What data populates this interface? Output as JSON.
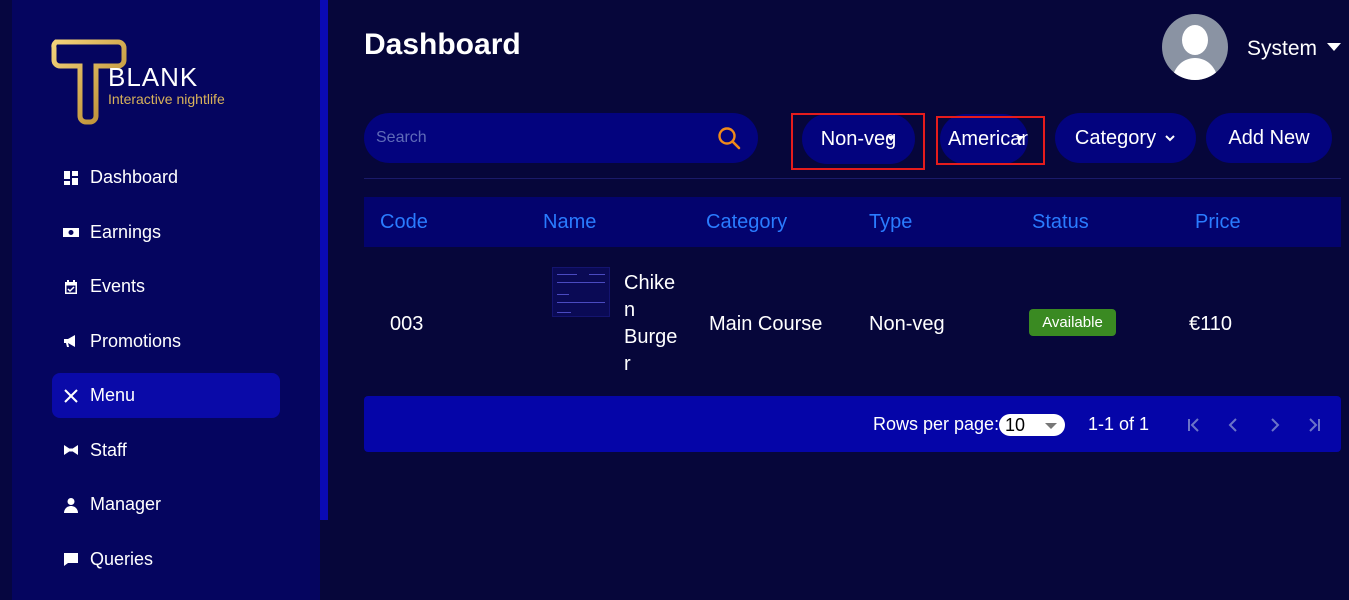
{
  "brand": {
    "title": "BLANK",
    "subtitle": "Interactive nightlife"
  },
  "sidebar": {
    "items": [
      {
        "label": "Dashboard",
        "icon": "dashboard-icon"
      },
      {
        "label": "Earnings",
        "icon": "money-icon"
      },
      {
        "label": "Events",
        "icon": "calendar-icon"
      },
      {
        "label": "Promotions",
        "icon": "megaphone-icon"
      },
      {
        "label": "Menu",
        "icon": "utensils-icon",
        "active": true
      },
      {
        "label": "Staff",
        "icon": "bowtie-icon"
      },
      {
        "label": "Manager",
        "icon": "manager-icon"
      },
      {
        "label": "Queries",
        "icon": "chat-icon"
      }
    ]
  },
  "header": {
    "title": "Dashboard",
    "user": "System"
  },
  "toolbar": {
    "search_placeholder": "Search",
    "filter_type": "Non-veg",
    "filter_cuisine": "American",
    "category_label": "Category",
    "add_label": "Add New"
  },
  "table": {
    "columns": [
      "Code",
      "Name",
      "Category",
      "Type",
      "Status",
      "Price"
    ],
    "rows": [
      {
        "code": "003",
        "name_lines": [
          "Chike",
          "n",
          "Burge",
          "r"
        ],
        "category": "Main Course",
        "type": "Non-veg",
        "status": "Available",
        "price": "€110"
      }
    ]
  },
  "pagination": {
    "rows_label": "Rows per page:",
    "rows_value": "10",
    "range": "1-1 of 1"
  },
  "colors": {
    "accent": "#2a7cff",
    "status_available": "#3a8a22",
    "highlight": "#e51c1c"
  }
}
